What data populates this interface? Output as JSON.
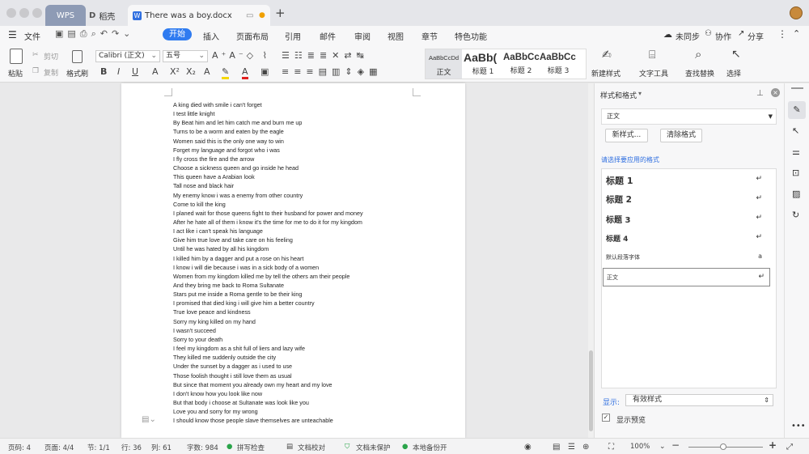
{
  "window": {
    "tabs": [
      {
        "label": "WPS"
      },
      {
        "label": "稻壳"
      },
      {
        "label": "There was a boy.docx"
      }
    ]
  },
  "menu": {
    "file": "文件",
    "tabs": [
      "开始",
      "插入",
      "页面布局",
      "引用",
      "邮件",
      "审阅",
      "视图",
      "章节",
      "特色功能"
    ],
    "sync": "未同步",
    "collab": "协作",
    "share": "分享"
  },
  "ribbon": {
    "paste": "粘贴",
    "cut": "剪切",
    "copy": "复制",
    "format_painter": "格式刷",
    "font_name": "Calibri (正文)",
    "font_size": "五号",
    "styles": [
      {
        "preview": "AaBbCcDd",
        "label": "正文"
      },
      {
        "preview": "AaBb(",
        "label": "标题 1"
      },
      {
        "preview": "AaBbCc",
        "label": "标题 2"
      },
      {
        "preview": "AaBbCc",
        "label": "标题 3"
      }
    ],
    "new_style": "新建样式",
    "text_tools": "文字工具",
    "find_replace": "查找替换",
    "select": "选择"
  },
  "document": {
    "lines": [
      "A king died with smile i can't forget",
      "I test little knight",
      "By Beat him and let him catch me and burn me up",
      "Turns to be a worm and eaten by the eagle",
      "Women said this is the only one way to win",
      "Forget my language and forgot who i was",
      "I fly cross the fire and the arrow",
      "Choose a sickness queen and go inside he head",
      "This queen have a Arabian look",
      "Tall nose and black hair",
      "My enemy know i was a enemy from other country",
      "Come to kill the king",
      "I planed wait for those queens fight to their husband for power and money",
      "After he hate all of them i know it's the time for me to do it for my kingdom",
      "I act like i can't speak his language",
      "Give him true love and take care on his feeling",
      "Until he was hated by all his kingdom",
      "I killed him by a dagger and put a rose on his heart",
      "I know i will die because i was in a sick body of a women",
      "Women from my kingdom killed me by tell the others am their people",
      "And they bring me back to Roma Sultanate",
      "Stars put me inside a Roma gentle to be their king",
      "I promised that died king i will give him a better country",
      "True love peace and kindness",
      "Sorry my king killed on my hand",
      "I wasn't succeed",
      "Sorry to your death",
      "I feel my kingdom as a shit full of liers and lazy wife",
      "They killed me suddenly outside the city",
      "Under the sunset by a dagger as i used to use",
      "Those foolish thought i still love them as usual",
      "But since that moment you already own my heart and my love",
      "I don't know how you look like now",
      "But that body i choose at Sultanate was look like you",
      "Love you and sorry for my wrong",
      "I should know those people slave themselves are unteachable"
    ]
  },
  "panel": {
    "title": "样式和格式",
    "current": "正文",
    "new_btn": "新样式...",
    "clear_btn": "清除格式",
    "hint": "请选择要应用的格式",
    "styles": [
      "标题 1",
      "标题 2",
      "标题 3",
      "标题 4",
      "默认段落字体",
      "正文"
    ],
    "show_label": "显示:",
    "show_value": "有效样式",
    "preview_label": "显示预览"
  },
  "status": {
    "page_num": "页码: 4",
    "pages": "页面: 4/4",
    "section": "节: 1/1",
    "row": "行: 36",
    "col": "列: 61",
    "words": "字数: 984",
    "spell": "拼写检查",
    "proof": "文档校对",
    "protect": "文档未保护",
    "backup": "本地备份开",
    "zoom": "100%"
  }
}
